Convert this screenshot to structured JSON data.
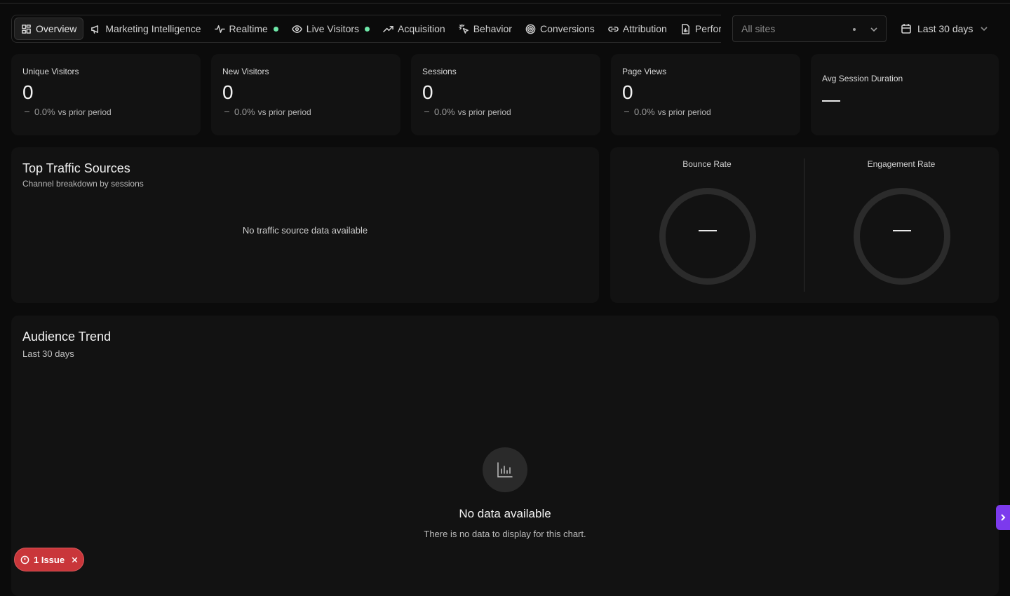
{
  "nav": {
    "tabs": [
      {
        "label": "Overview",
        "icon": "grid-icon",
        "active": true
      },
      {
        "label": "Marketing Intelligence",
        "icon": "megaphone-icon"
      },
      {
        "label": "Realtime",
        "icon": "pulse-icon",
        "live": true
      },
      {
        "label": "Live Visitors",
        "icon": "eye-icon",
        "live": true
      },
      {
        "label": "Acquisition",
        "icon": "trend-up-icon"
      },
      {
        "label": "Behavior",
        "icon": "cursor-click-icon"
      },
      {
        "label": "Conversions",
        "icon": "target-icon"
      },
      {
        "label": "Attribution",
        "icon": "link-icon"
      },
      {
        "label": "Perform",
        "icon": "file-icon"
      }
    ]
  },
  "filters": {
    "site_placeholder": "All sites",
    "date_range": "Last 30 days"
  },
  "kpis": [
    {
      "label": "Unique Visitors",
      "value": "0",
      "delta": "0.0%",
      "vs": "vs prior period"
    },
    {
      "label": "New Visitors",
      "value": "0",
      "delta": "0.0%",
      "vs": "vs prior period"
    },
    {
      "label": "Sessions",
      "value": "0",
      "delta": "0.0%",
      "vs": "vs prior period"
    },
    {
      "label": "Page Views",
      "value": "0",
      "delta": "0.0%",
      "vs": "vs prior period"
    },
    {
      "label": "Avg Session Duration"
    }
  ],
  "traffic": {
    "title": "Top Traffic Sources",
    "subtitle": "Channel breakdown by sessions",
    "empty": "No traffic source data available"
  },
  "rates": {
    "bounce_label": "Bounce Rate",
    "engagement_label": "Engagement Rate"
  },
  "trend": {
    "title": "Audience Trend",
    "subtitle": "Last 30 days",
    "empty_title": "No data available",
    "empty_sub": "There is no data to display for this chart."
  },
  "issues": {
    "label": "1 Issue"
  },
  "colors": {
    "accent": "#7c3aed",
    "live": "#6ee7a8",
    "error": "#c9363a"
  }
}
